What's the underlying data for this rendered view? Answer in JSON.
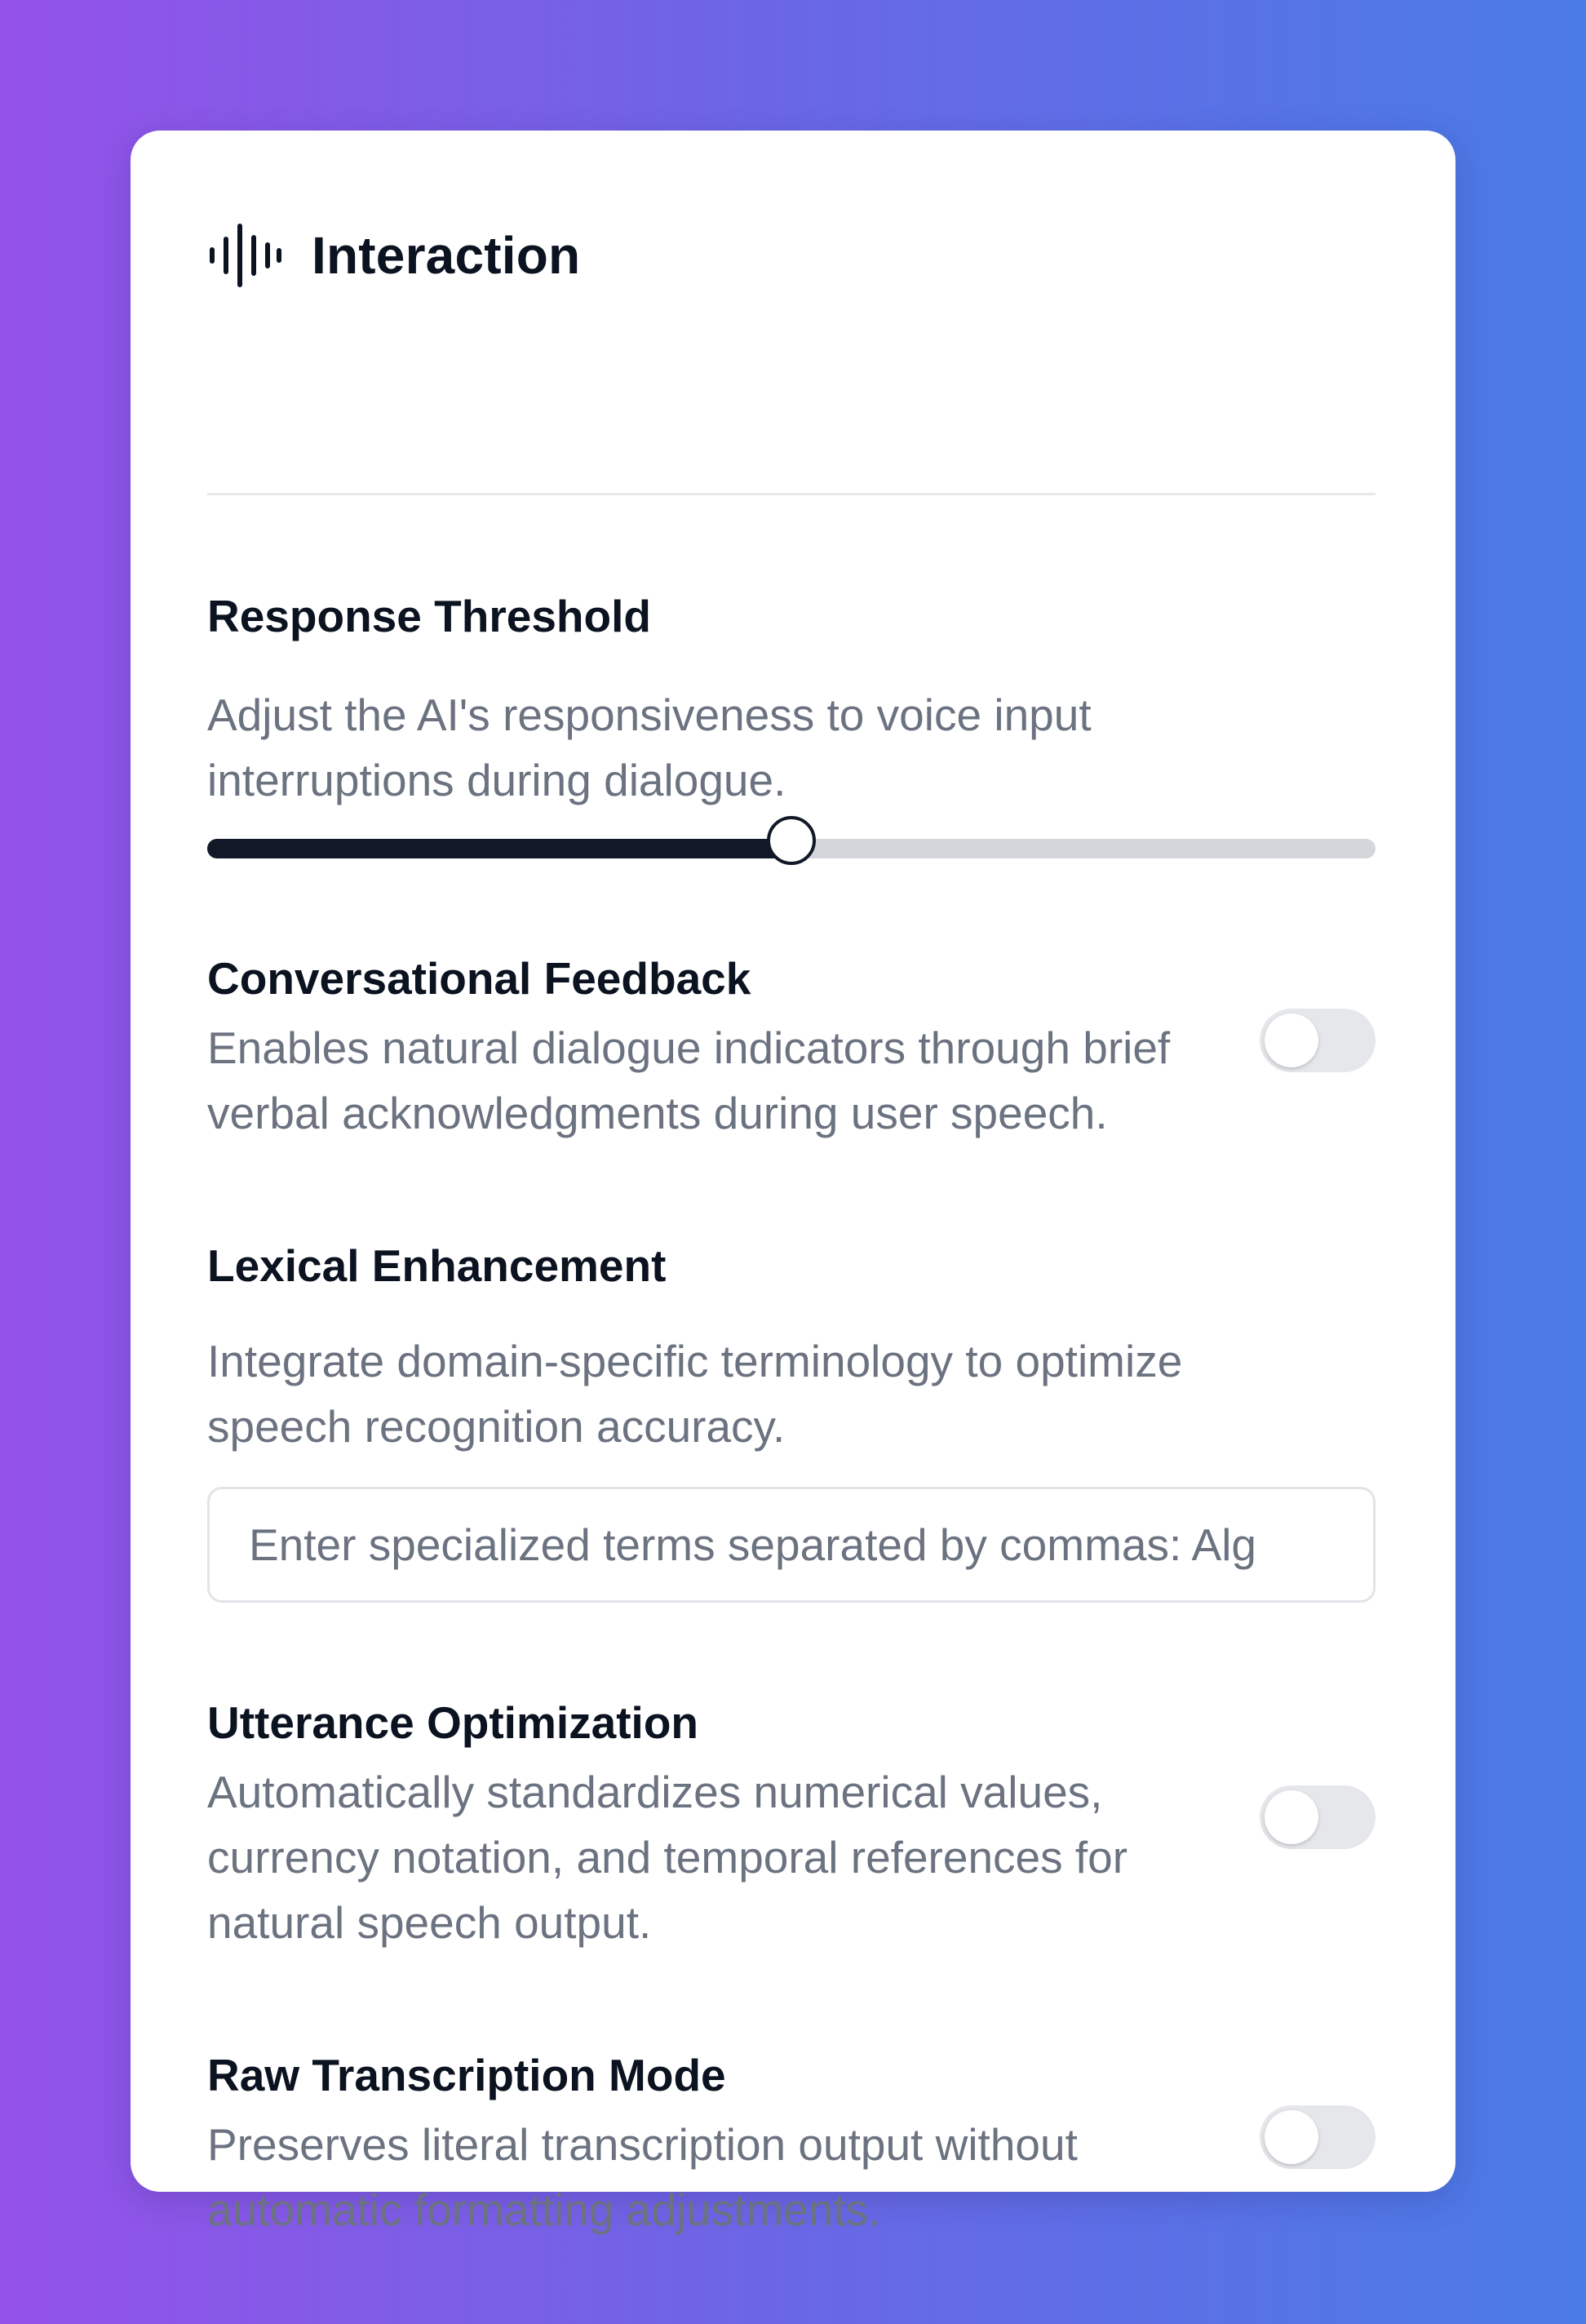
{
  "panel": {
    "title": "Interaction",
    "title_icon": "waveform-icon"
  },
  "response_threshold": {
    "label": "Response Threshold",
    "description_line1": "Adjust the AI's responsiveness to voice input",
    "description_line2": "interruptions during dialogue.",
    "slider_value": 0.5
  },
  "conversational_feedback": {
    "label": "Conversational Feedback",
    "description_line1": "Enables natural dialogue indicators through brief",
    "description_line2": "verbal acknowledgments during user speech.",
    "enabled": false
  },
  "lexical_enhancement": {
    "label": "Lexical Enhancement",
    "description_line1": "Integrate domain-specific terminology to optimize",
    "description_line2": "speech recognition accuracy.",
    "input_value": "",
    "input_placeholder": "Enter specialized terms separated by commas: Alg"
  },
  "utterance_optimization": {
    "label": "Utterance Optimization",
    "description_line1": "Automatically standardizes numerical values,",
    "description_line2": "currency notation, and temporal references for",
    "description_line3": "natural speech output.",
    "enabled": false
  },
  "raw_transcription_mode": {
    "label": "Raw Transcription Mode",
    "description_line1": "Preserves literal transcription output without",
    "description_line2": "automatic formatting adjustments.",
    "enabled": false
  },
  "colors": {
    "accent": "#111827",
    "toggle_off": "#e5e7eb",
    "muted_text": "#6b7280",
    "background_start": "#9452e8",
    "background_end": "#4a7be6"
  }
}
